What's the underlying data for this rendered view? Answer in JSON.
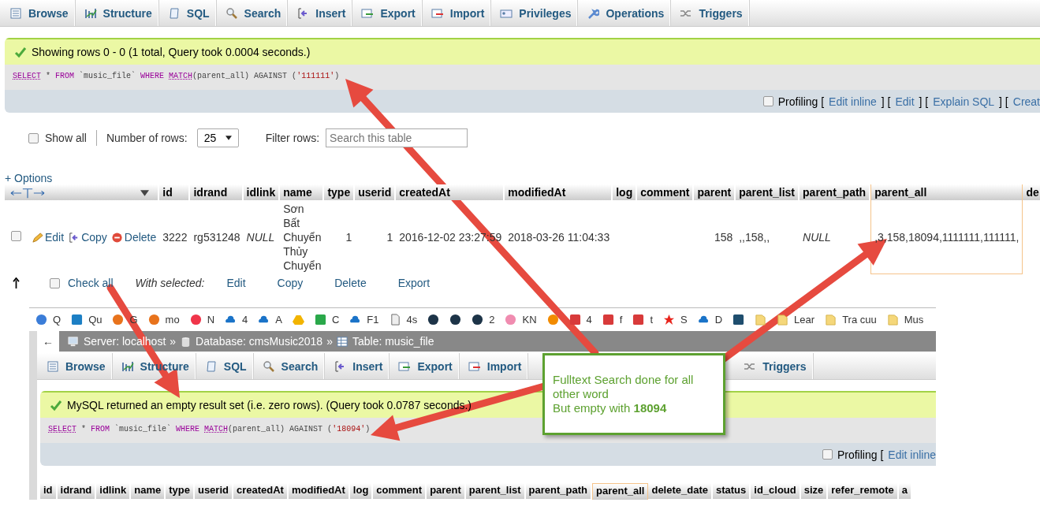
{
  "result_view": {
    "tabs": [
      {
        "label": "Browse",
        "kind": "browse"
      },
      {
        "label": "Structure",
        "kind": "structure"
      },
      {
        "label": "SQL",
        "kind": "sql"
      },
      {
        "label": "Search",
        "kind": "search"
      },
      {
        "label": "Insert",
        "kind": "insert"
      },
      {
        "label": "Export",
        "kind": "export"
      },
      {
        "label": "Import",
        "kind": "import"
      },
      {
        "label": "Privileges",
        "kind": "privileges"
      },
      {
        "label": "Operations",
        "kind": "operations"
      },
      {
        "label": "Triggers",
        "kind": "triggers"
      }
    ],
    "message": "Showing rows 0 - 0 (1 total, Query took 0.0004 seconds.)",
    "query": [
      {
        "text": "SELECT",
        "kind": "keyword"
      },
      {
        "text": " * ",
        "kind": "plain"
      },
      {
        "text": "FROM",
        "kind": "function"
      },
      {
        "text": " `music_file` ",
        "kind": "plain"
      },
      {
        "text": "WHERE ",
        "kind": "function"
      },
      {
        "text": "MATCH",
        "kind": "keyword"
      },
      {
        "text": "(parent_all) AGAINST (",
        "kind": "plain"
      },
      {
        "text": "'111111'",
        "kind": "string"
      },
      {
        "text": ")",
        "kind": "plain"
      }
    ],
    "profiling": {
      "checked": false,
      "items": [
        {
          "text": "Profiling [",
          "kind": "text"
        },
        {
          "text": "Edit inline",
          "kind": "link"
        },
        {
          "text": "] [",
          "kind": "text"
        },
        {
          "text": "Edit",
          "kind": "link"
        },
        {
          "text": "] [",
          "kind": "text"
        },
        {
          "text": "Explain SQL",
          "kind": "link"
        },
        {
          "text": "] [",
          "kind": "text"
        },
        {
          "text": "Creat",
          "kind": "link"
        }
      ]
    },
    "show_all": {
      "label": "Show all",
      "checked": false
    },
    "rows_per_page": {
      "label": "Number of rows:",
      "value": "25"
    },
    "filter": {
      "label": "Filter rows:",
      "placeholder": "Search this table"
    },
    "options_link": "+ Options",
    "table": {
      "columns": [
        {
          "label": "id",
          "highlighted": false
        },
        {
          "label": "idrand",
          "highlighted": false
        },
        {
          "label": "idlink",
          "highlighted": false
        },
        {
          "label": "name",
          "highlighted": false
        },
        {
          "label": "type",
          "highlighted": false
        },
        {
          "label": "userid",
          "highlighted": false
        },
        {
          "label": "createdAt",
          "highlighted": false
        },
        {
          "label": "modifiedAt",
          "highlighted": false
        },
        {
          "label": "log",
          "highlighted": false
        },
        {
          "label": "comment",
          "highlighted": false
        },
        {
          "label": "parent",
          "highlighted": false
        },
        {
          "label": "parent_list",
          "highlighted": false
        },
        {
          "label": "parent_path",
          "highlighted": false
        },
        {
          "label": "parent_all",
          "highlighted": true
        },
        {
          "label": "de",
          "highlighted": false
        }
      ],
      "rows": [
        {
          "checked": false,
          "actions": [
            "Edit",
            "Copy",
            "Delete"
          ],
          "cells": [
            {
              "text": "3222",
              "kind": "number"
            },
            {
              "text": "rg531248",
              "kind": "text"
            },
            {
              "text": "NULL",
              "kind": "null"
            },
            {
              "text": "Sơn Bất Chuyển Thủy Chuyển",
              "kind": "wrap"
            },
            {
              "text": "1",
              "kind": "number"
            },
            {
              "text": "1",
              "kind": "number"
            },
            {
              "text": "2016-12-02 23:27:59",
              "kind": "text"
            },
            {
              "text": "2018-03-26 11:04:33",
              "kind": "text"
            },
            null,
            null,
            {
              "text": "158",
              "kind": "number"
            },
            {
              "text": ",,158,,",
              "kind": "text"
            },
            {
              "text": "NULL",
              "kind": "null"
            },
            {
              "text": ",3,158,18094,1111111,111111,",
              "kind": "text"
            },
            null
          ]
        }
      ]
    },
    "bulk": {
      "checked": false,
      "check_all": "Check all",
      "with_selected": "With selected:",
      "actions": [
        "Edit",
        "Copy",
        "Delete",
        "Export"
      ]
    }
  },
  "browser": {
    "bookmarks": [
      {
        "label": "Q",
        "kind": "circle",
        "color": "#3b7dd8"
      },
      {
        "label": "Qu",
        "kind": "square",
        "color": "#1c7fc4"
      },
      {
        "label": "G",
        "kind": "circle",
        "color": "#e8731c"
      },
      {
        "label": "mo",
        "kind": "circle",
        "color": "#e8731c"
      },
      {
        "label": "N",
        "kind": "circle",
        "color": "#f0354a"
      },
      {
        "label": "4",
        "kind": "cloud",
        "color": "#1a73c8"
      },
      {
        "label": "A",
        "kind": "cloud",
        "color": "#1a73c8"
      },
      {
        "kind": "drive",
        "color": "#f2b400"
      },
      {
        "label": "C",
        "kind": "square",
        "color": "#2aa84a"
      },
      {
        "label": "F1",
        "kind": "cloud",
        "color": "#1a73c8"
      },
      {
        "label": "4s",
        "kind": "file",
        "color": "#eeeeee"
      },
      {
        "kind": "circle",
        "color": "#1d3448"
      },
      {
        "kind": "circle",
        "color": "#1d3448"
      },
      {
        "label": "2",
        "kind": "circle",
        "color": "#1d3448"
      },
      {
        "label": "KN",
        "kind": "circle",
        "color": "#f08cb0"
      },
      {
        "kind": "circle",
        "color": "#f28b00"
      },
      {
        "label": "4",
        "kind": "square",
        "color": "#d83a3a"
      },
      {
        "label": "f",
        "kind": "square",
        "color": "#d83a3a"
      },
      {
        "label": "t",
        "kind": "square",
        "color": "#d83a3a"
      },
      {
        "label": "S",
        "kind": "star",
        "color": "#e8231b"
      },
      {
        "label": "D",
        "kind": "cloud",
        "color": "#1a73c8"
      },
      {
        "kind": "square",
        "color": "#1f4e6e"
      },
      {
        "kind": "folder",
        "color": "#f5d77a"
      },
      {
        "label": "Lear",
        "kind": "folder",
        "color": "#f5d77a"
      },
      {
        "label": "Tra cuu",
        "kind": "folder",
        "color": "#f5d77a"
      },
      {
        "label": "Mus",
        "kind": "folder",
        "color": "#f5d77a"
      }
    ]
  },
  "empty_view": {
    "breadcrumb": [
      {
        "label": "Server: localhost",
        "kind": "server"
      },
      {
        "label": "Database: cmsMusic2018",
        "kind": "database"
      },
      {
        "label": "Table: music_file",
        "kind": "table"
      }
    ],
    "separator": "»",
    "back": "←",
    "tabs": [
      {
        "label": "Browse",
        "kind": "browse"
      },
      {
        "label": "Structure",
        "kind": "structure"
      },
      {
        "label": "SQL",
        "kind": "sql"
      },
      {
        "label": "Search",
        "kind": "search"
      },
      {
        "label": "Insert",
        "kind": "insert"
      },
      {
        "label": "Export",
        "kind": "export"
      },
      {
        "label": "Import",
        "kind": "import"
      },
      {
        "label": "Triggers",
        "kind": "triggers"
      }
    ],
    "message": "MySQL returned an empty result set (i.e. zero rows). (Query took 0.0787 seconds.)",
    "query": [
      {
        "text": "SELECT",
        "kind": "keyword"
      },
      {
        "text": " * ",
        "kind": "plain"
      },
      {
        "text": "FROM",
        "kind": "function"
      },
      {
        "text": " `music_file` ",
        "kind": "plain"
      },
      {
        "text": "WHERE ",
        "kind": "function"
      },
      {
        "text": "MATCH",
        "kind": "keyword"
      },
      {
        "text": "(parent_all) AGAINST (",
        "kind": "plain"
      },
      {
        "text": "'18094'",
        "kind": "string"
      },
      {
        "text": ")",
        "kind": "plain"
      }
    ],
    "profiling": {
      "checked": false,
      "items": [
        {
          "text": "Profiling [",
          "kind": "text"
        },
        {
          "text": "Edit inline",
          "kind": "link"
        }
      ]
    },
    "columns": [
      {
        "label": "id",
        "highlighted": false
      },
      {
        "label": "idrand",
        "highlighted": false
      },
      {
        "label": "idlink",
        "highlighted": false
      },
      {
        "label": "name",
        "highlighted": false
      },
      {
        "label": "type",
        "highlighted": false
      },
      {
        "label": "userid",
        "highlighted": false
      },
      {
        "label": "createdAt",
        "highlighted": false
      },
      {
        "label": "modifiedAt",
        "highlighted": false
      },
      {
        "label": "log",
        "highlighted": false
      },
      {
        "label": "comment",
        "highlighted": false
      },
      {
        "label": "parent",
        "highlighted": false
      },
      {
        "label": "parent_list",
        "highlighted": false
      },
      {
        "label": "parent_path",
        "highlighted": false
      },
      {
        "label": "parent_all",
        "highlighted": true
      },
      {
        "label": "delete_date",
        "highlighted": false
      },
      {
        "label": "status",
        "highlighted": false
      },
      {
        "label": "id_cloud",
        "highlighted": false
      },
      {
        "label": "size",
        "highlighted": false
      },
      {
        "label": "refer_remote",
        "highlighted": false
      },
      {
        "label": "a",
        "highlighted": false
      }
    ]
  },
  "callout": {
    "lines": [
      "Fulltext Search done for all other word",
      "But empty with **18094**"
    ]
  }
}
